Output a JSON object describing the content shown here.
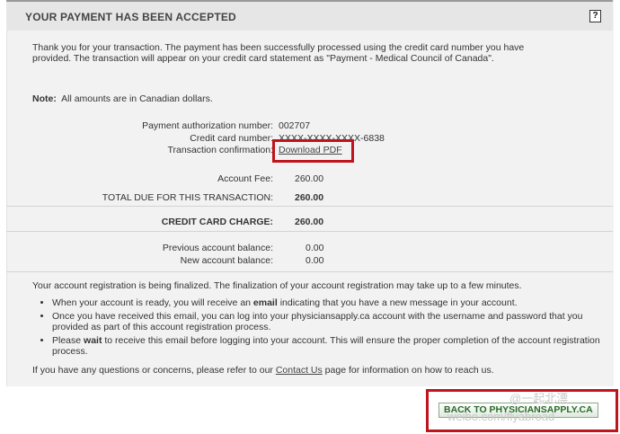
{
  "header": {
    "title": "YOUR PAYMENT HAS BEEN ACCEPTED",
    "help_glyph": "?"
  },
  "intro": "Thank you for your transaction. The payment has been successfully processed using the credit card number you have provided. The transaction will appear on your credit card statement as \"Payment - Medical Council of Canada\".",
  "note": {
    "label": "Note:",
    "text": "All amounts are in Canadian dollars."
  },
  "details": {
    "auth_label": "Payment authorization number:",
    "auth_value": "002707",
    "card_label": "Credit card number:",
    "card_value": "XXXX-XXXX-XXXX-6838",
    "confirm_label": "Transaction confirmation:",
    "confirm_link": "Download PDF"
  },
  "fees": {
    "account_fee_label": "Account Fee:",
    "account_fee_value": "260.00",
    "total_label": "TOTAL DUE FOR THIS TRANSACTION:",
    "total_value": "260.00",
    "charge_label": "CREDIT CARD CHARGE:",
    "charge_value": "260.00"
  },
  "balances": {
    "previous_label": "Previous account balance:",
    "previous_value": "0.00",
    "new_label": "New account balance:",
    "new_value": "0.00"
  },
  "registration": "Your account registration is being finalized. The finalization of your account registration may take up to a few minutes.",
  "bullets": [
    {
      "pre": "When your account is ready, you will receive an ",
      "bold": "email",
      "post": " indicating that you have a new message in your account."
    },
    {
      "pre": "Once you have received this email, you can log into your physiciansapply.ca account with the username and password that you provided as part of this account registration process.",
      "bold": "",
      "post": ""
    },
    {
      "pre": "Please ",
      "bold": "wait",
      "post": " to receive this email before logging into your account. This will ensure the proper completion of the account registration process."
    }
  ],
  "contact": {
    "pre": "If you have any questions or concerns, please refer to our ",
    "link": "Contact Us",
    "post": " page for information on how to reach us."
  },
  "back_button": "BACK TO PHYSICIANSAPPLY.CA",
  "watermark": {
    "line1": "@一起北漂",
    "line2": "weibo.com/flyabroad"
  },
  "colors": {
    "highlight": "#c0141c",
    "panel": "#f2f2f2",
    "button_text": "#2a6b2a"
  }
}
